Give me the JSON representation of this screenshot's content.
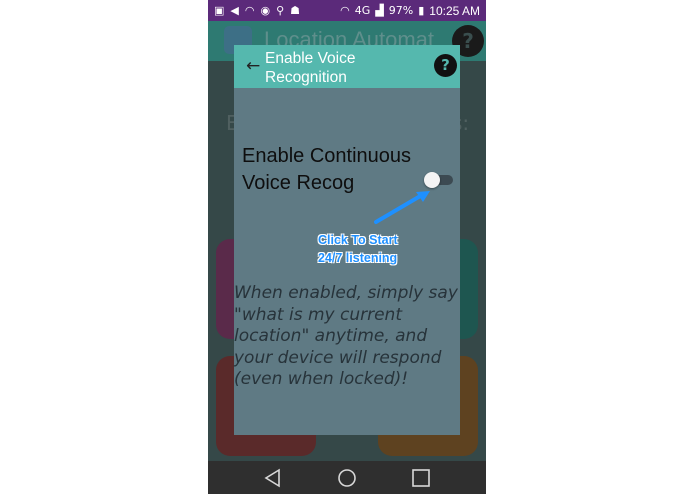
{
  "status_bar": {
    "network": "4G",
    "battery": "97%",
    "time": "10:25 AM"
  },
  "background_app": {
    "title": "Location Automat",
    "body_left": "E",
    "body_right": "s:",
    "tile_colors": [
      "#a11a6a",
      "#0f7a5e",
      "#a11a1a",
      "#a8580a"
    ]
  },
  "dialog": {
    "title": "Enable Voice Recognition",
    "option_label": "Enable Continuous Voice Recog",
    "toggle_on": false,
    "description": "When enabled, simply say \"what is my current location\" anytime, and your device will respond (even when locked)!"
  },
  "annotation": {
    "line1": "Click To Start",
    "line2": "24/7 listening"
  },
  "icons": {
    "back": "arrow-left-icon",
    "help": "help-circle-icon",
    "nav_back": "triangle-back-icon",
    "nav_home": "circle-home-icon",
    "nav_recents": "square-recents-icon"
  },
  "colors": {
    "status_bar": "#5b2a7a",
    "dialog_header": "#55b8ae",
    "dialog_body": "#5f7a84",
    "annotation": "#1e90ff"
  }
}
